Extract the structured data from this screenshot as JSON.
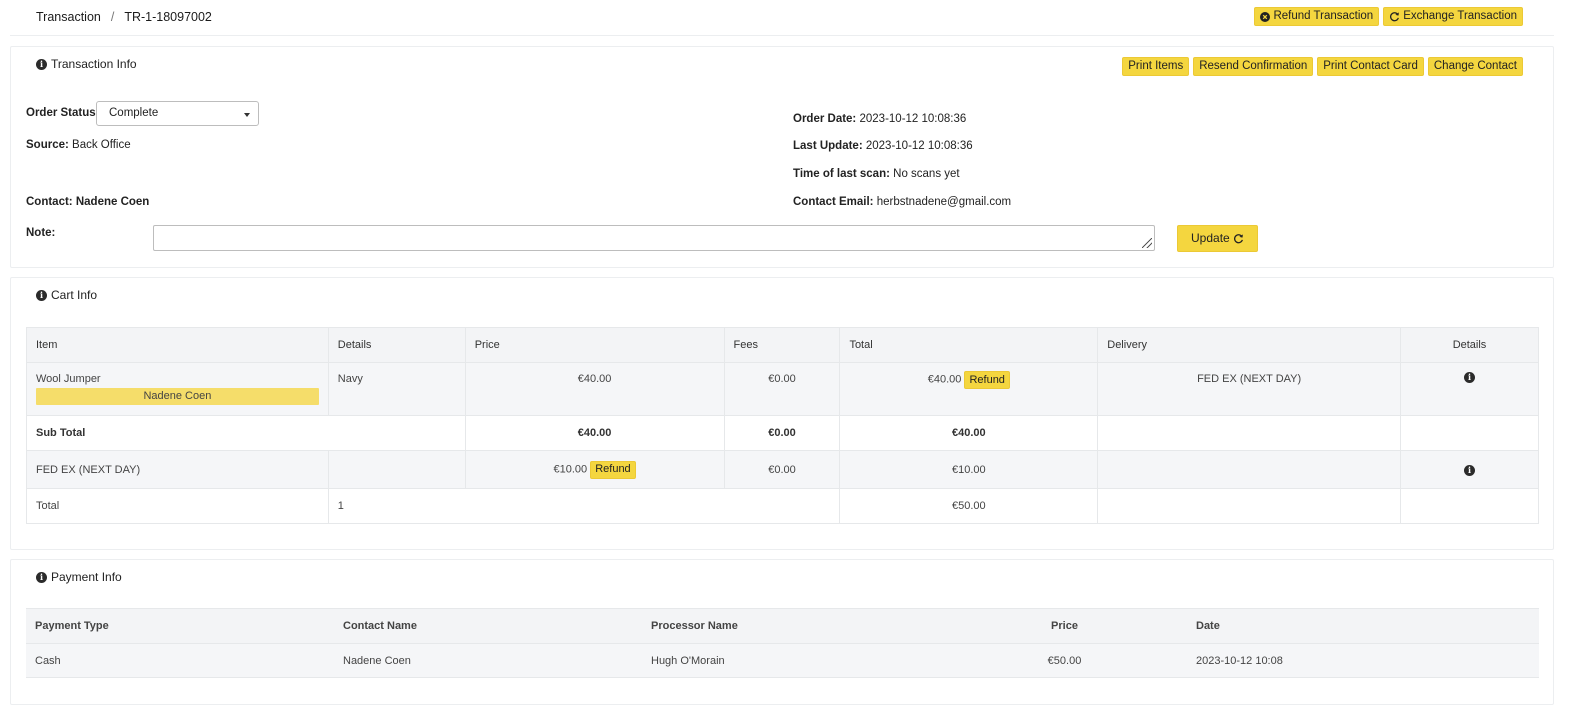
{
  "breadcrumb": {
    "root": "Transaction",
    "separator": "/",
    "current": "TR-1-18097002"
  },
  "top_actions": {
    "refund": "Refund Transaction",
    "exchange": "Exchange Transaction"
  },
  "transaction_info": {
    "title": "Transaction Info",
    "actions": {
      "print_items": "Print Items",
      "resend_confirmation": "Resend Confirmation",
      "print_contact_card": "Print Contact Card",
      "change_contact": "Change Contact"
    },
    "order_status_label": "Order Status:",
    "order_status_value": "Complete",
    "source_label": "Source:",
    "source_value": "Back Office",
    "contact_label": "Contact:",
    "contact_value": "Nadene Coen",
    "note_label": "Note:",
    "note_value": "",
    "order_date_label": "Order Date:",
    "order_date_value": "2023-10-12 10:08:36",
    "last_update_label": "Last Update:",
    "last_update_value": "2023-10-12 10:08:36",
    "last_scan_label": "Time of last scan:",
    "last_scan_value": "No scans yet",
    "contact_email_label": "Contact Email:",
    "contact_email_value": "herbstnadene@gmail.com",
    "update_label": "Update"
  },
  "cart_info": {
    "title": "Cart Info",
    "headers": [
      "Item",
      "Details",
      "Price",
      "Fees",
      "Total",
      "Delivery",
      "Details"
    ],
    "item_row": {
      "item": "Wool Jumper",
      "holder": "Nadene Coen",
      "details": "Navy",
      "price": "€40.00",
      "fees": "€0.00",
      "total": "€40.00",
      "refund_label": "Refund",
      "delivery": "FED EX (NEXT DAY)"
    },
    "subtotal_row": {
      "label": "Sub Total",
      "price": "€40.00",
      "fees": "€0.00",
      "total": "€40.00"
    },
    "shipping_row": {
      "label": "FED EX (NEXT DAY)",
      "price": "€10.00",
      "refund_label": "Refund",
      "fees": "€0.00",
      "total": "€10.00"
    },
    "total_row": {
      "label": "Total",
      "count": "1",
      "total": "€50.00"
    }
  },
  "payment_info": {
    "title": "Payment Info",
    "headers": [
      "Payment Type",
      "Contact Name",
      "Processor Name",
      "Price",
      "Date"
    ],
    "rows": [
      {
        "type": "Cash",
        "contact": "Nadene Coen",
        "processor": "Hugh O'Morain",
        "price": "€50.00",
        "date": "2023-10-12 10:08"
      }
    ]
  },
  "colors": {
    "accent_yellow": "#f4d63f",
    "badge_yellow": "#f5dd6a"
  }
}
